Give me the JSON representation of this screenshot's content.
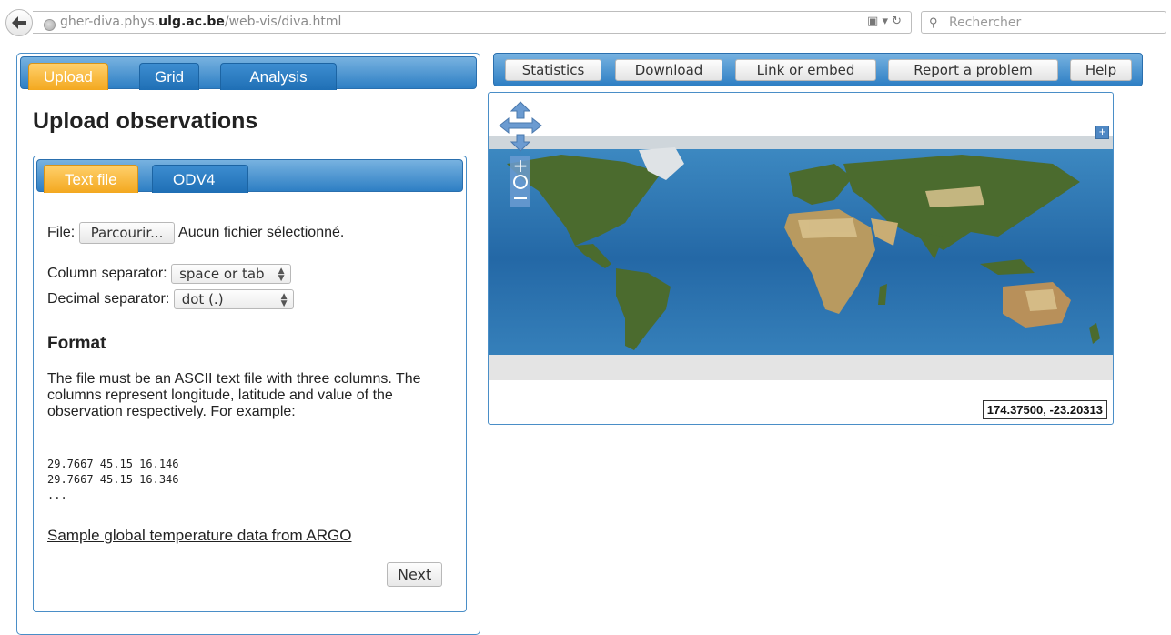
{
  "browser": {
    "url_host_prefix": "gher-diva.phys.",
    "url_host_bold": "ulg.ac.be",
    "url_path": "/web-vis/diva.html",
    "search_placeholder": "Rechercher"
  },
  "left_panel": {
    "tabs": [
      "Upload",
      "Grid",
      "Analysis"
    ],
    "active_tab": "Upload",
    "title": "Upload observations",
    "sub_tabs": [
      "Text file",
      "ODV4"
    ],
    "active_sub_tab": "Text file",
    "file_label": "File:",
    "browse_button": "Parcourir...",
    "no_file": "Aucun fichier sélectionné.",
    "column_separator_label": "Column separator:",
    "column_separator_value": "space or tab",
    "decimal_separator_label": "Decimal separator:",
    "decimal_separator_value": "dot (.)",
    "format_heading": "Format",
    "format_description": "The file must be an ASCII text file with three columns. The columns represent longitude, latitude and value of the observation respectively. For example:",
    "example_lines": [
      "29.7667 45.15 16.146",
      "29.7667 45.15 16.346",
      "..."
    ],
    "sample_link": "Sample global temperature data from ARGO",
    "next_button": "Next"
  },
  "toolbar": {
    "buttons": [
      "Statistics",
      "Download",
      "Link or embed",
      "Report a problem",
      "Help"
    ]
  },
  "map": {
    "coordinates": "174.37500, -23.20313",
    "colors": {
      "ocean": "#2f78b0",
      "land": "#4b6b2e",
      "ice": "#e4e4e4"
    }
  },
  "colors": {
    "tab_active": "#f3a81f",
    "tab_bar": "#2e7fc4",
    "panel_border": "#4a8ec7"
  }
}
